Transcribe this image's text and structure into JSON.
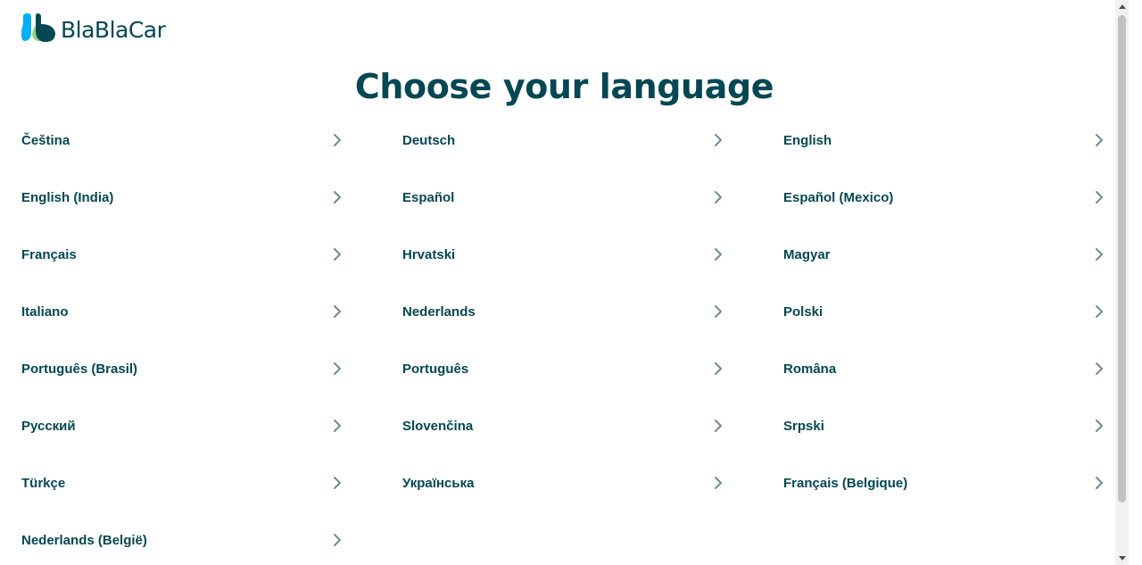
{
  "header": {
    "logo_text": "BlaBlaCar",
    "logo_icon": "blablacar-logo-icon"
  },
  "page": {
    "title": "Choose your language"
  },
  "languages": [
    {
      "label": "Čeština"
    },
    {
      "label": "Deutsch"
    },
    {
      "label": "English"
    },
    {
      "label": "English (India)"
    },
    {
      "label": "Español"
    },
    {
      "label": "Español (Mexico)"
    },
    {
      "label": "Français"
    },
    {
      "label": "Hrvatski"
    },
    {
      "label": "Magyar"
    },
    {
      "label": "Italiano"
    },
    {
      "label": "Nederlands"
    },
    {
      "label": "Polski"
    },
    {
      "label": "Português (Brasil)"
    },
    {
      "label": "Português"
    },
    {
      "label": "Româna"
    },
    {
      "label": "Русский"
    },
    {
      "label": "Slovenčina"
    },
    {
      "label": "Srpski"
    },
    {
      "label": "Türkçe"
    },
    {
      "label": "Українська"
    },
    {
      "label": "Français (Belgique)"
    },
    {
      "label": "Nederlands (België)"
    }
  ],
  "icons": {
    "row_chevron": "chevron-right-icon"
  },
  "colors": {
    "brand_dark": "#054752",
    "brand_light": "#00AFF5",
    "chevron": "#708C91"
  }
}
